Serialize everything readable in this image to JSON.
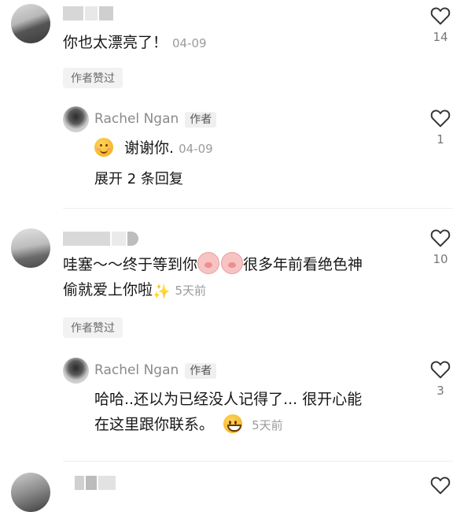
{
  "comments": [
    {
      "text": "你也太漂亮了！",
      "time": "04-09",
      "author_liked": "作者赞过",
      "likes": "14",
      "replies": [
        {
          "name": "Rachel Ngan",
          "author_tag": "作者",
          "text": "谢谢你.",
          "time": "04-09",
          "likes": "1",
          "expand": "展开 2 条回复",
          "emoji": "relieved-face-icon"
        }
      ]
    },
    {
      "text_line1": "哇塞～～终于等到你",
      "text_line1b": "很多年前看绝色神",
      "text_line2": "偷就爱上你啦",
      "time": "5天前",
      "author_liked": "作者赞过",
      "likes": "10",
      "replies": [
        {
          "name": "Rachel Ngan",
          "author_tag": "作者",
          "text_line1": "哈哈..还以为已经没人记得了... 很开心能",
          "text_line2": "在这里跟你联系。",
          "time": "5天前",
          "likes": "3",
          "emoji": "grinning-face-icon"
        }
      ]
    }
  ],
  "icons": {
    "heart": "heart-outline-icon",
    "pig": "pig-face-icon",
    "sparkle": "sparkles-icon"
  },
  "colors": {
    "muted": "#9b9b9b",
    "text": "#161616"
  }
}
